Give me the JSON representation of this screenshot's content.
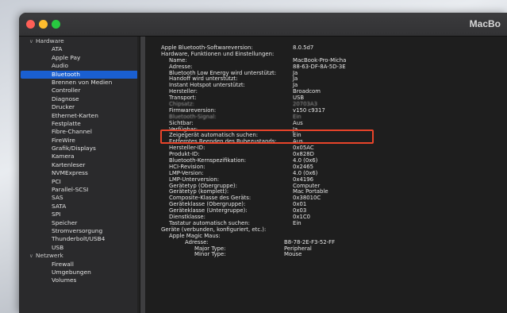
{
  "window": {
    "title": "MacBo"
  },
  "sidebar": {
    "items": [
      {
        "label": "Hardware",
        "category": true
      },
      {
        "label": "ATA"
      },
      {
        "label": "Apple Pay"
      },
      {
        "label": "Audio"
      },
      {
        "label": "Bluetooth",
        "selected": true
      },
      {
        "label": "Brennen von Medien"
      },
      {
        "label": "Controller"
      },
      {
        "label": "Diagnose"
      },
      {
        "label": "Drucker"
      },
      {
        "label": "Ethernet-Karten"
      },
      {
        "label": "Festplatte"
      },
      {
        "label": "Fibre-Channel"
      },
      {
        "label": "FireWire"
      },
      {
        "label": "Grafik/Displays"
      },
      {
        "label": "Kamera"
      },
      {
        "label": "Kartenleser"
      },
      {
        "label": "NVMExpress"
      },
      {
        "label": "PCI"
      },
      {
        "label": "Parallel-SCSI"
      },
      {
        "label": "SAS"
      },
      {
        "label": "SATA"
      },
      {
        "label": "SPI"
      },
      {
        "label": "Speicher"
      },
      {
        "label": "Stromversorgung"
      },
      {
        "label": "Thunderbolt/USB4"
      },
      {
        "label": "USB"
      },
      {
        "label": "Netzwerk",
        "category": true
      },
      {
        "label": "Firewall"
      },
      {
        "label": "Umgebungen"
      },
      {
        "label": "Volumes"
      }
    ]
  },
  "content": {
    "rows": [
      {
        "label": "Apple Bluetooth-Softwareversion:",
        "value": "8.0.5d7",
        "indent": 0
      },
      {
        "label": "Hardware, Funktionen und Einstellungen:",
        "value": "",
        "indent": 0
      },
      {
        "label": "Name:",
        "value": "MacBook-Pro-Micha",
        "indent": 1
      },
      {
        "label": "Adresse:",
        "value": "88-63-DF-8A-5D-3E",
        "indent": 1
      },
      {
        "label": "Bluetooth Low Energy wird unterstützt:",
        "value": "Ja",
        "indent": 1
      },
      {
        "label": "Handoff wird unterstützt:",
        "value": "Ja",
        "indent": 1
      },
      {
        "label": "Instant Hotspot unterstützt:",
        "value": "Ja",
        "indent": 1
      },
      {
        "label": "Hersteller:",
        "value": "Broadcom",
        "indent": 1
      },
      {
        "label": "Transport:",
        "value": "USB",
        "indent": 1
      },
      {
        "label": "Chipsatz:",
        "value": "20703A3",
        "indent": 1,
        "blurred": true
      },
      {
        "label": "Firmwareversion:",
        "value": "v150 c9317",
        "indent": 1
      },
      {
        "label": "Bluetooth-Signal:",
        "value": "Ein",
        "indent": 1,
        "blurred": true
      },
      {
        "label": "Sichtbar:",
        "value": "Aus",
        "indent": 1
      },
      {
        "label": "Verfügbar:",
        "value": "Ja",
        "indent": 1
      },
      {
        "label": "Zeigegerät automatisch suchen:",
        "value": "Ein",
        "indent": 1
      },
      {
        "label": "Entferntes Beenden des Ruhezustands:",
        "value": "Aus",
        "indent": 1
      },
      {
        "label": "Hersteller-ID:",
        "value": "0x05AC",
        "indent": 1
      },
      {
        "label": "Produkt-ID:",
        "value": "0x828D",
        "indent": 1
      },
      {
        "label": "Bluetooth-Kernspezifikation:",
        "value": "4.0 (0x6)",
        "indent": 1
      },
      {
        "label": "HCI-Revision:",
        "value": "0x2465",
        "indent": 1
      },
      {
        "label": "LMP-Version:",
        "value": "4.0 (0x6)",
        "indent": 1
      },
      {
        "label": "LMP-Unterversion:",
        "value": "0x4196",
        "indent": 1
      },
      {
        "label": "Gerätetyp (Obergruppe):",
        "value": "Computer",
        "indent": 1
      },
      {
        "label": "Gerätetyp (komplett):",
        "value": "Mac Portable",
        "indent": 1
      },
      {
        "label": "Composite-Klasse des Geräts:",
        "value": "0x38010C",
        "indent": 1
      },
      {
        "label": "Geräteklasse (Obergruppe):",
        "value": "0x01",
        "indent": 1
      },
      {
        "label": "Geräteklasse (Untergruppe):",
        "value": "0x03",
        "indent": 1
      },
      {
        "label": "Dienstklasse:",
        "value": "0x1C0",
        "indent": 1
      },
      {
        "label": "Tastatur automatisch suchen:",
        "value": "Ein",
        "indent": 1
      },
      {
        "label": "Geräte (verbunden, konfiguriert, etc.):",
        "value": "",
        "indent": 0
      },
      {
        "label": "Apple Magic Maus:",
        "value": "",
        "indent": 1
      },
      {
        "label": "Adresse:",
        "value": "B8-78-2E-F3-52-FF",
        "indent": 2
      },
      {
        "label": "Major Type:",
        "value": "Peripheral",
        "indent": 3
      },
      {
        "label": "Minor Type:",
        "value": "Mouse",
        "indent": 3
      }
    ]
  },
  "colors": {
    "selection": "#1a5fd1",
    "highlight_box": "#e8442a",
    "window_bg": "#1e1e1e",
    "sidebar_bg": "#2a2a2c"
  },
  "icons": [
    "close-icon",
    "minimize-icon",
    "zoom-icon",
    "chevron-down-icon"
  ]
}
